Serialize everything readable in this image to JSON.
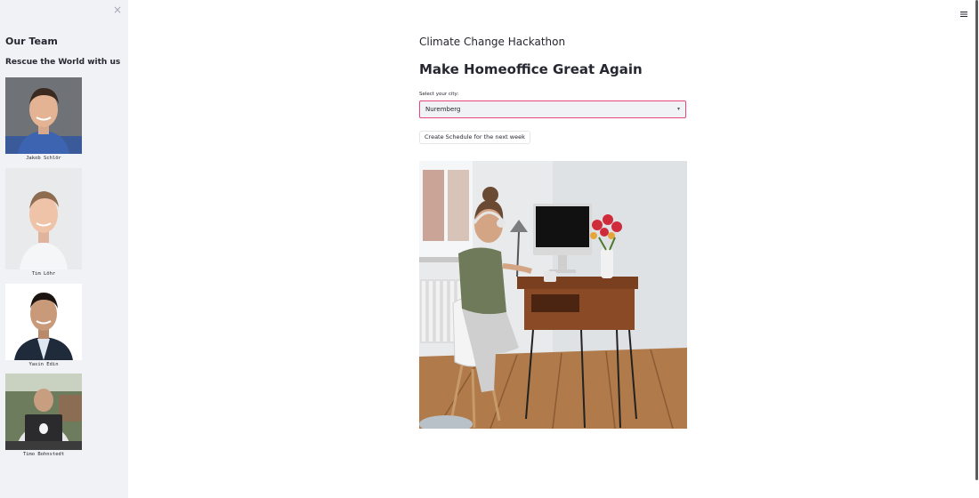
{
  "sidebar": {
    "close_icon": "×",
    "heading": "Our Team",
    "subheading": "Rescue the World with us",
    "members": [
      {
        "name": "Jakob Schlör"
      },
      {
        "name": "Tim Löhr"
      },
      {
        "name": "Yasin Edin"
      },
      {
        "name": "Timo Bohnstedt"
      }
    ]
  },
  "main": {
    "app_title": "Climate Change Hackathon",
    "page_title": "Make Homeoffice Great Again",
    "city_select": {
      "label": "Select your city:",
      "value": "Nuremberg"
    },
    "schedule_button": "Create Schedule for the next week"
  },
  "header": {
    "menu_icon": "hamburger-menu-icon"
  },
  "colors": {
    "sidebar_bg": "#f0f2f6",
    "accent": "#e8457a",
    "text": "#262730"
  }
}
